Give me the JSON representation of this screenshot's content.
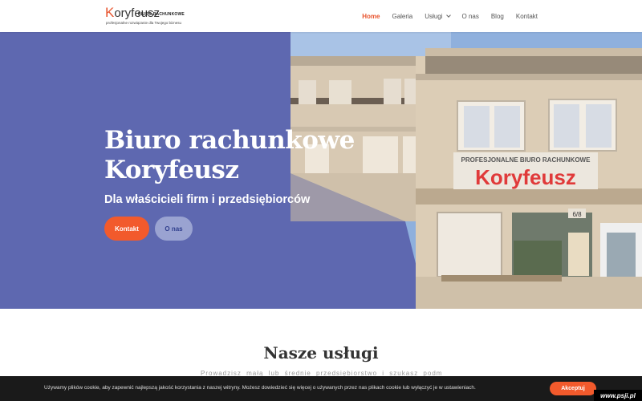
{
  "logo": {
    "brand_k": "K",
    "brand_rest": "oryfeusz",
    "tag": "BIURO RACHUNKOWE",
    "subtitle": "profesjonalne rozwiązanie dla Twojego biznesu"
  },
  "nav": {
    "items": [
      {
        "label": "Home",
        "active": true
      },
      {
        "label": "Galeria"
      },
      {
        "label": "Usługi",
        "dropdown": true
      },
      {
        "label": "O nas"
      },
      {
        "label": "Blog"
      },
      {
        "label": "Kontakt"
      }
    ]
  },
  "hero": {
    "title_line1": "Biuro rachunkowe",
    "title_line2": "Koryfeusz",
    "subtitle": "Dla właścicieli firm i przedsiębiorców",
    "primary_button": "Kontakt",
    "secondary_button": "O nas",
    "sign_line1": "PROFESJONALNE BIURO RACHUNKOWE",
    "sign_line2": "Koryfeusz",
    "house_number": "6/8"
  },
  "services": {
    "title": "Nasze usługi",
    "text": "Prowadzisz małą lub średnie przedsiębiorstwo i szukasz podmiotu, który"
  },
  "cookie": {
    "text": "Używamy plików cookie, aby zapewnić najlepszą jakość korzystania z naszej witryny. Możesz dowiedzieć się więcej o używanych przez nas plikach cookie lub wyłączyć je w ustawieniach.",
    "accept": "Akceptuj"
  },
  "watermark": "www.psji.pl",
  "colors": {
    "accent": "#f25a2c",
    "hero_bg": "#5e68b0",
    "cookie_bg": "#1a1a1a"
  }
}
